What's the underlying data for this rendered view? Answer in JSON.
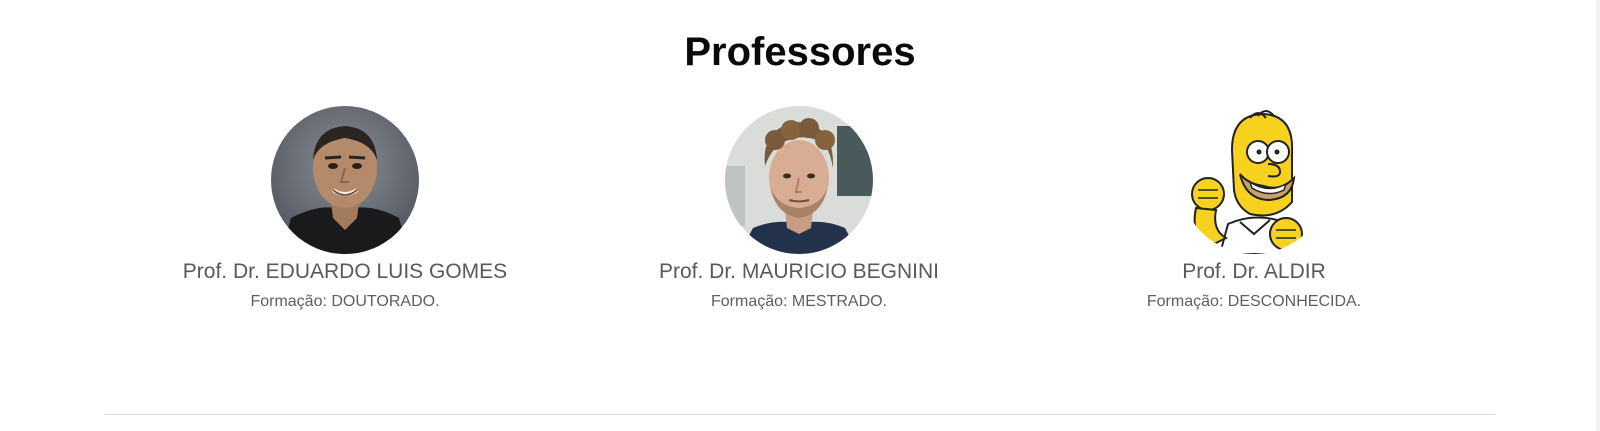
{
  "section": {
    "title": "Professores"
  },
  "professors": [
    {
      "name": "Prof. Dr. EDUARDO LUIS GOMES",
      "degree": "Formação: DOUTORADO."
    },
    {
      "name": "Prof. Dr. MAURICIO BEGNINI",
      "degree": "Formação: MESTRADO."
    },
    {
      "name": "Prof. Dr. ALDIR",
      "degree": "Formação: DESCONHECIDA."
    }
  ],
  "colors": {
    "title": "#0a0a0a",
    "name_text": "#555a5f",
    "degree_text": "#5a5f64",
    "divider": "#dcdcdc"
  }
}
